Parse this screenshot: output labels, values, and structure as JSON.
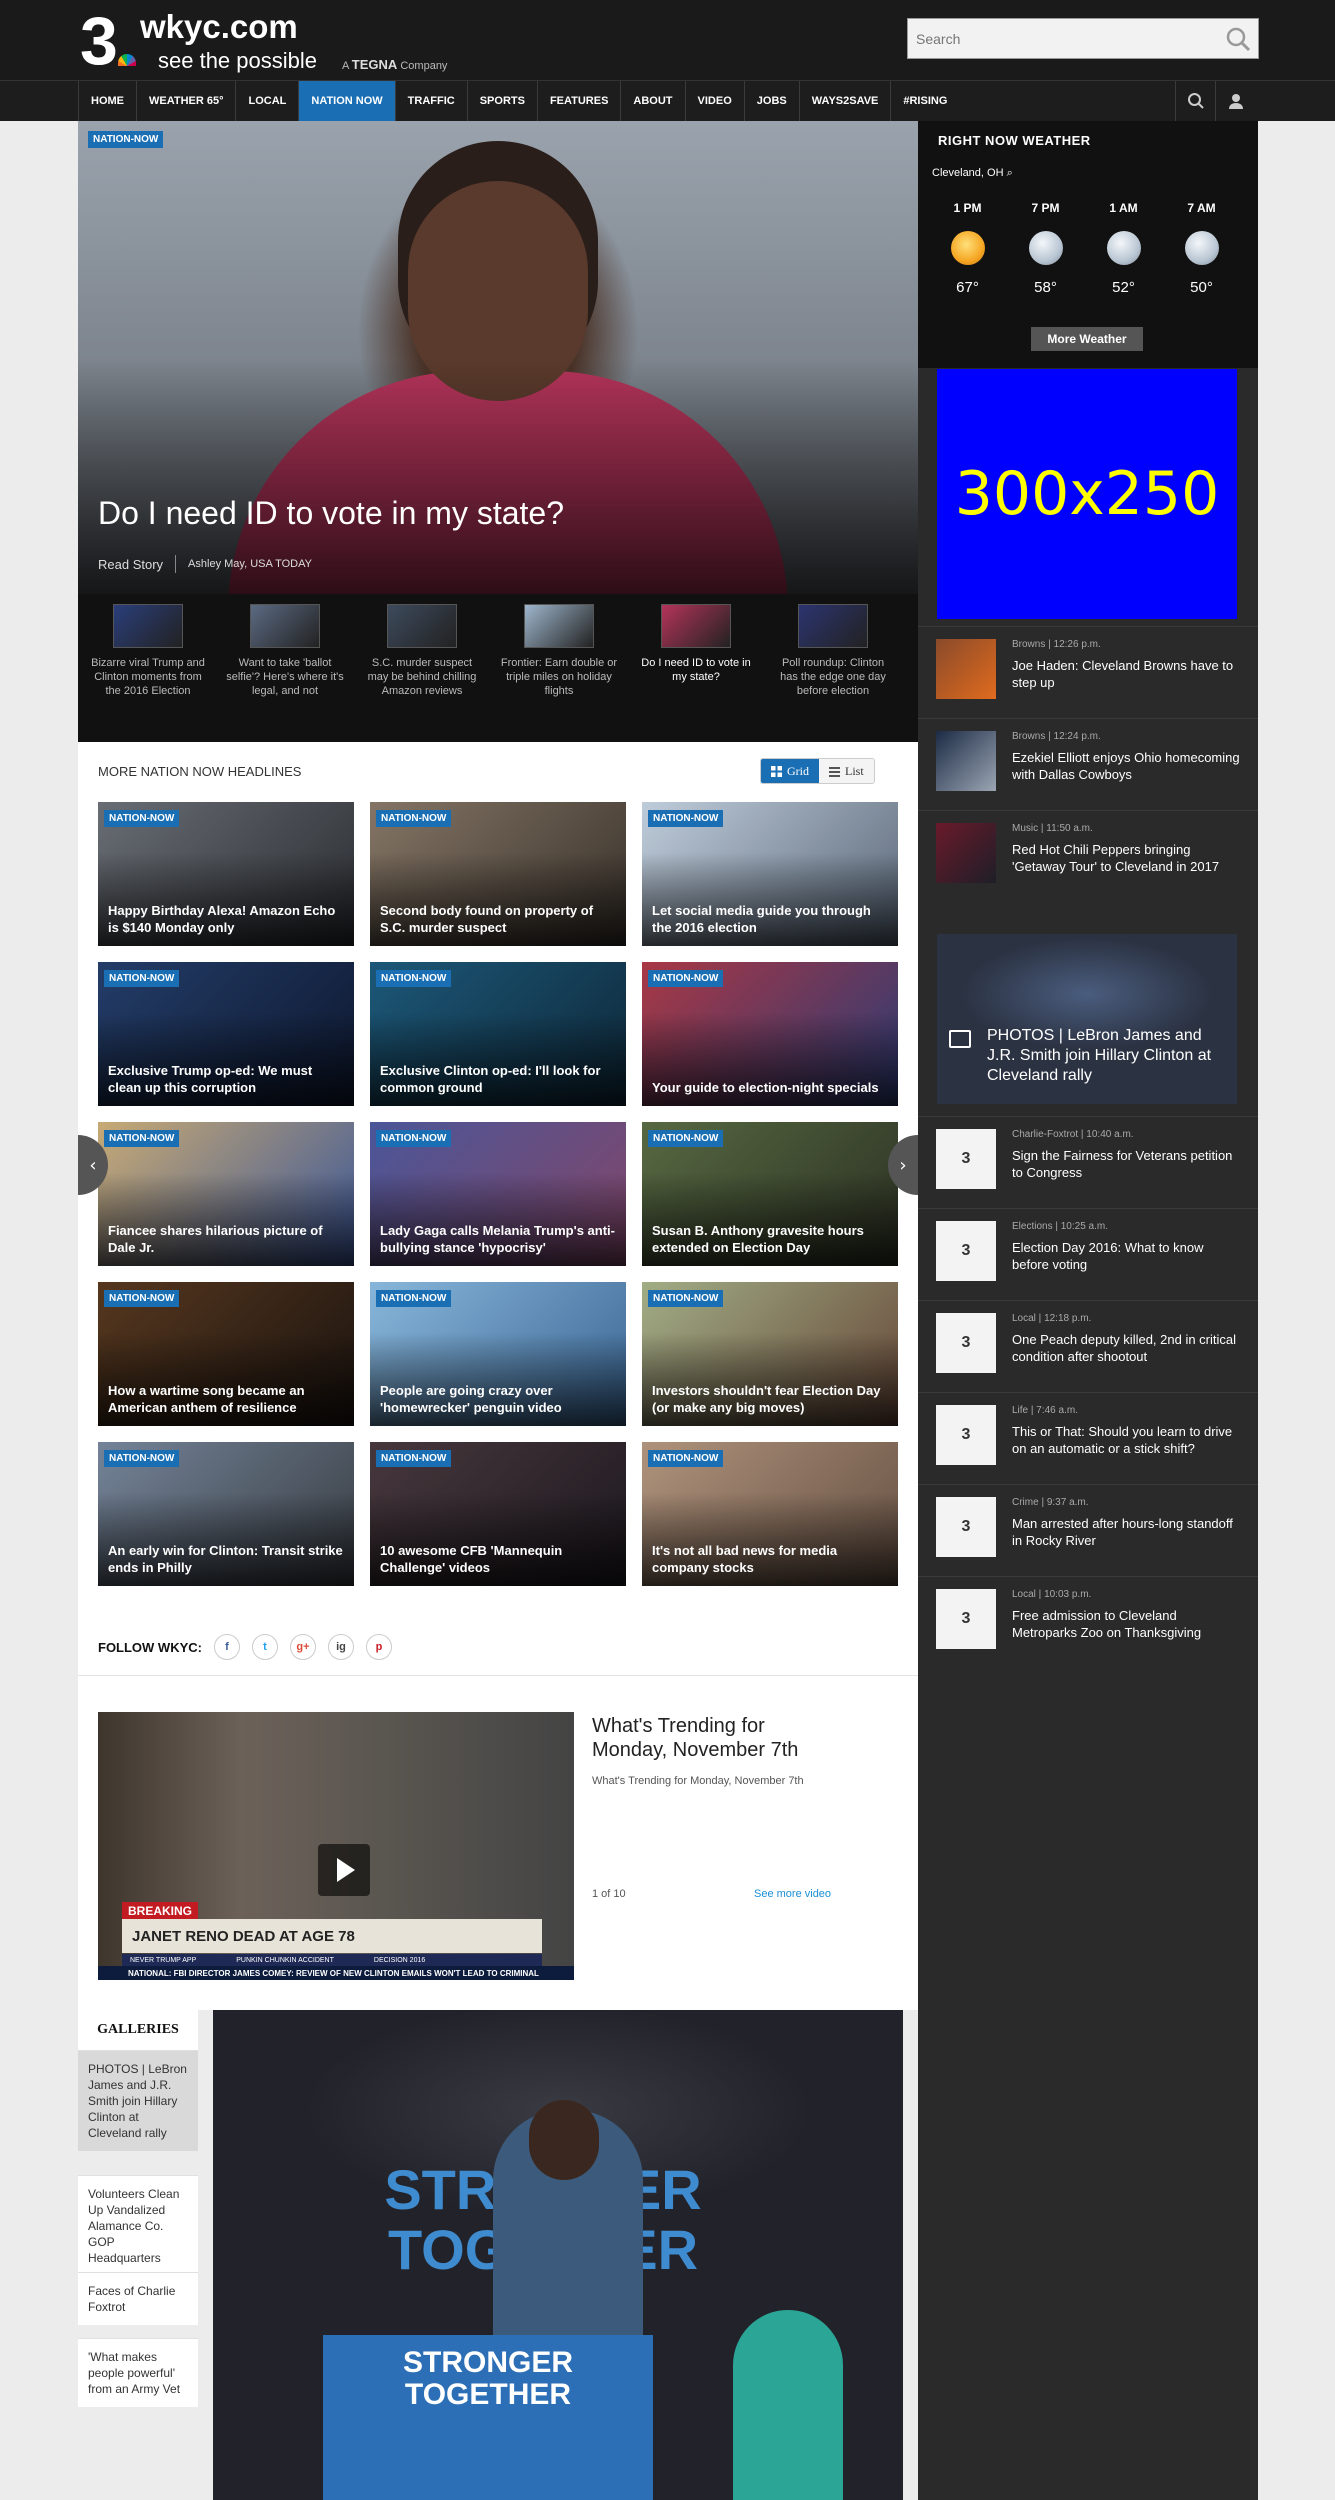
{
  "header": {
    "logo_number": "3",
    "logo_domain": "wkyc.com",
    "logo_tagline": "see the possible",
    "logo_company_prefix": "A",
    "logo_company": "TEGNA",
    "logo_company_suffix": "Company",
    "search_placeholder": "Search"
  },
  "nav": {
    "items": [
      "HOME",
      "WEATHER 65°",
      "LOCAL",
      "NATION NOW",
      "TRAFFIC",
      "SPORTS",
      "FEATURES",
      "ABOUT",
      "VIDEO",
      "JOBS",
      "WAYS2SAVE",
      "#RISING"
    ],
    "active": "NATION NOW"
  },
  "hero": {
    "tag": "NATION-NOW",
    "title": "Do I need ID to vote in my state?",
    "read_story": "Read Story",
    "byline": "Ashley May, USA TODAY"
  },
  "hero_strip": [
    {
      "text": "Bizarre viral Trump and Clinton moments from the 2016 Election"
    },
    {
      "text": "Want to take 'ballot selfie'? Here's where it's legal, and not"
    },
    {
      "text": "S.C. murder suspect may be behind chilling Amazon reviews"
    },
    {
      "text": "Frontier: Earn double or triple miles on holiday flights"
    },
    {
      "text": "Do I need ID to vote in my state?"
    },
    {
      "text": "Poll roundup: Clinton has the edge one day before election"
    }
  ],
  "more": {
    "heading": "MORE NATION NOW HEADLINES",
    "grid_label": "Grid",
    "list_label": "List",
    "tag": "NATION-NOW",
    "cards": [
      "Happy Birthday Alexa! Amazon Echo is $140 Monday only",
      "Second body found on property of S.C. murder suspect",
      "Let social media guide you through the 2016 election",
      "Exclusive Trump op-ed: We must clean up this corruption",
      "Exclusive Clinton op-ed: I'll look for common ground",
      "Your guide to election-night specials",
      "Fiancee shares hilarious picture of Dale Jr.",
      "Lady Gaga calls Melania Trump's anti-bullying stance 'hypocrisy'",
      "Susan B. Anthony gravesite hours extended on Election Day",
      "How a wartime song became an American anthem of resilience",
      "People are going crazy over 'homewrecker' penguin video",
      "Investors shouldn't fear Election Day (or make any big moves)",
      "An early win for Clinton: Transit strike ends in Philly",
      "10 awesome CFB 'Mannequin Challenge' videos",
      "It's not all bad news for media company stocks"
    ]
  },
  "follow": {
    "label": "FOLLOW WKYC:",
    "networks": [
      "f",
      "t",
      "g+",
      "ig",
      "p"
    ]
  },
  "video": {
    "title": "What's Trending for Monday, November 7th",
    "subtitle": "What's Trending for Monday, November 7th",
    "count": "1 of 10",
    "see_more": "See more video",
    "breaking": "BREAKING",
    "lower_third": "JANET RENO DEAD AT AGE 78",
    "ticker_items": [
      "NEVER TRUMP APP",
      "PUNKIN CHUNKIN ACCIDENT",
      "DECISION 2016"
    ],
    "crawl": "NATIONAL: FBI DIRECTOR JAMES COMEY: REVIEW OF NEW CLINTON EMAILS WON'T LEAD TO CRIMINAL",
    "prev_arrow": "‹",
    "next_arrow": "›"
  },
  "galleries": {
    "title": "GALLERIES",
    "items": [
      "PHOTOS | LeBron James and J.R. Smith join Hillary Clinton at Cleveland rally",
      "Volunteers Clean Up Vandalized Alamance Co. GOP Headquarters",
      "Faces of Charlie Foxtrot",
      "'What makes people powerful' from an Army Vet"
    ],
    "banner_text": "STRONGER TOGETHER",
    "podium_text": "STRONGER TOGETHER"
  },
  "weather": {
    "title": "RIGHT NOW WEATHER",
    "location": "Cleveland, OH",
    "hours": [
      {
        "time": "1 PM",
        "temp": "67°",
        "icon": "sun-icon"
      },
      {
        "time": "7 PM",
        "temp": "58°",
        "icon": "moon-icon"
      },
      {
        "time": "1 AM",
        "temp": "52°",
        "icon": "moon-icon"
      },
      {
        "time": "7 AM",
        "temp": "50°",
        "icon": "moon-icon"
      }
    ],
    "more_button": "More Weather"
  },
  "ad": {
    "text": "300x250"
  },
  "rail_stories_top": [
    {
      "category": "Browns",
      "time": "12:26 p.m.",
      "headline": "Joe Haden: Cleveland Browns have to step up"
    },
    {
      "category": "Browns",
      "time": "12:24 p.m.",
      "headline": "Ezekiel Elliott enjoys Ohio homecoming with Dallas Cowboys"
    },
    {
      "category": "Music",
      "time": "11:50 a.m.",
      "headline": "Red Hot Chili Peppers bringing 'Getaway Tour' to Cleveland in 2017"
    }
  ],
  "rail_photo_feature": {
    "headline": "PHOTOS | LeBron James and J.R. Smith join Hillary Clinton at Cleveland rally"
  },
  "rail_stories_bottom": [
    {
      "category": "Charlie-Foxtrot",
      "time": "10:40 a.m.",
      "headline": "Sign the Fairness for Veterans petition to Congress"
    },
    {
      "category": "Elections",
      "time": "10:25 a.m.",
      "headline": "Election Day 2016: What to know before voting"
    },
    {
      "category": "Local",
      "time": "12:18 p.m.",
      "headline": "One Peach deputy killed, 2nd in critical condition after shootout"
    },
    {
      "category": "Life",
      "time": "7:46 a.m.",
      "headline": "This or That: Should you learn to drive on an automatic or a stick shift?"
    },
    {
      "category": "Crime",
      "time": "9:37 a.m.",
      "headline": "Man arrested after hours-long standoff in Rocky River"
    },
    {
      "category": "Local",
      "time": "10:03 p.m.",
      "headline": "Free admission to Cleveland Metroparks Zoo on Thanksgiving"
    }
  ],
  "rail_logo_text": "3"
}
